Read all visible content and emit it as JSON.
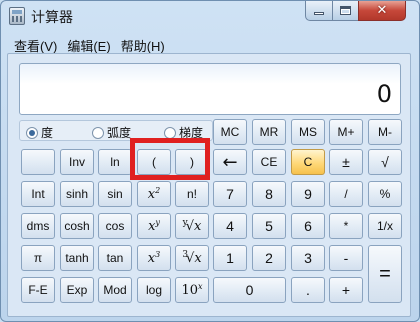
{
  "window": {
    "title": "计算器",
    "controls": {
      "minimize": "minimize",
      "maximize": "maximize",
      "close": "✕"
    }
  },
  "menu": [
    "查看(V)",
    "编辑(E)",
    "帮助(H)"
  ],
  "display": {
    "value": "0"
  },
  "angle_modes": [
    {
      "label": "度",
      "checked": true
    },
    {
      "label": "弧度",
      "checked": false
    },
    {
      "label": "梯度",
      "checked": false
    }
  ],
  "memory_buttons": [
    "MC",
    "MR",
    "MS",
    "M+",
    "M-"
  ],
  "buttons": {
    "r2": [
      "",
      "Inv",
      "ln",
      "(",
      ")",
      "←",
      "CE",
      "C",
      "±",
      "√"
    ],
    "r3": [
      "Int",
      "sinh",
      "sin",
      "x",
      "n!",
      "7",
      "8",
      "9",
      "/",
      "%"
    ],
    "r4": [
      "dms",
      "cosh",
      "cos",
      "x",
      "x",
      "4",
      "5",
      "6",
      "*",
      "1/x"
    ],
    "r5": [
      "π",
      "tanh",
      "tan",
      "x",
      "x",
      "1",
      "2",
      "3",
      "-",
      "="
    ],
    "r6": [
      "F-E",
      "Exp",
      "Mod",
      "log",
      "10",
      "0",
      ".",
      "+"
    ]
  },
  "superscripts": {
    "x2": "2",
    "xy": "y",
    "yroot": "y",
    "x3": "3",
    "3root": "3",
    "10x": "x"
  },
  "highlight": {
    "color": "#e02020"
  }
}
